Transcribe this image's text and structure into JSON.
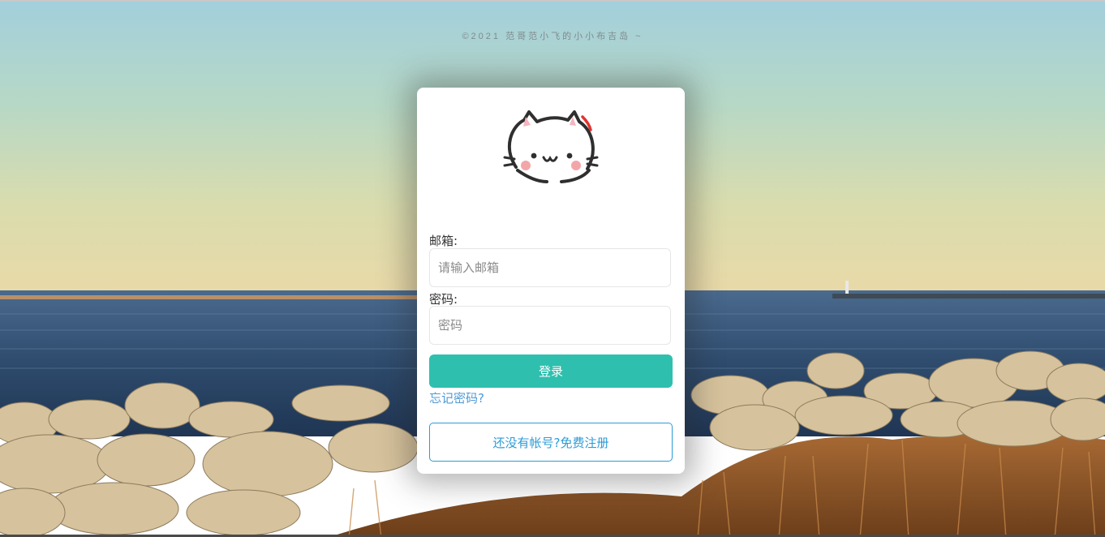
{
  "footer": {
    "copyright": "©2021 范哥范小飞的小小布吉岛 ~"
  },
  "login": {
    "avatar_icon": "cat-face-icon",
    "email_label": "邮箱:",
    "email_placeholder": "请输入邮箱",
    "email_value": "",
    "password_label": "密码:",
    "password_placeholder": "密码",
    "password_value": "",
    "submit_label": "登录",
    "forgot_label": "忘记密码?",
    "register_label": "还没有帐号?免费注册"
  },
  "colors": {
    "accent": "#2fbfae",
    "link": "#4f9ad6",
    "register_border": "#2d9bd6"
  }
}
